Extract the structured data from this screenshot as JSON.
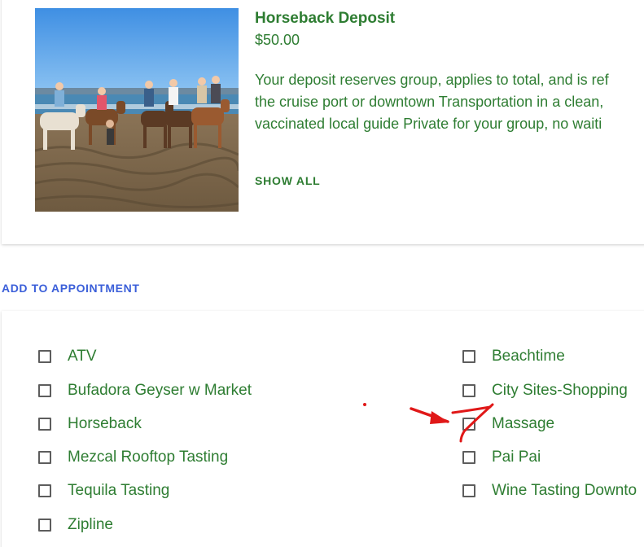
{
  "product": {
    "title": "Horseback Deposit",
    "price": "$50.00",
    "description_lines": [
      "Your deposit reserves group, applies to total, and is ref",
      "the cruise port or downtown Transportation in a clean,",
      "vaccinated local guide Private for your group, no waiti"
    ],
    "show_all_label": "SHOW ALL",
    "image_alt": "Horseback riders on the beach"
  },
  "add_to_appointment_label": "ADD TO APPOINTMENT",
  "options": {
    "left": [
      {
        "label": "ATV",
        "checked": false
      },
      {
        "label": "Bufadora Geyser w Market",
        "checked": false
      },
      {
        "label": "Horseback",
        "checked": false
      },
      {
        "label": "Mezcal Rooftop Tasting",
        "checked": false
      },
      {
        "label": "Tequila Tasting",
        "checked": false
      },
      {
        "label": "Zipline",
        "checked": false
      }
    ],
    "right": [
      {
        "label": "Beachtime",
        "checked": false
      },
      {
        "label": "City Sites-Shopping",
        "checked": false
      },
      {
        "label": "Massage",
        "checked": false
      },
      {
        "label": "Pai Pai",
        "checked": false
      },
      {
        "label": "Wine Tasting Downto",
        "checked": false
      }
    ]
  },
  "colors": {
    "text_green": "#2e7d32",
    "link_blue": "#3b5fd9",
    "annotation_red": "#e01818"
  }
}
